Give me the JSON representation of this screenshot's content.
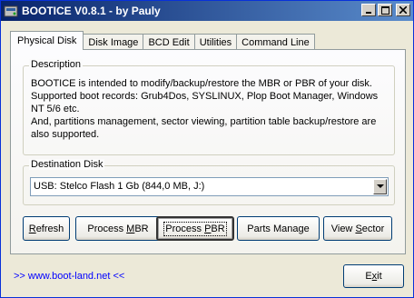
{
  "window": {
    "title": "BOOTICE V0.8.1 - by Pauly",
    "controls": {
      "minimize": "_",
      "maximize": "□",
      "close": "×"
    }
  },
  "tabs": [
    {
      "label": "Physical Disk",
      "active": true
    },
    {
      "label": "Disk Image",
      "active": false
    },
    {
      "label": "BCD Edit",
      "active": false
    },
    {
      "label": "Utilities",
      "active": false
    },
    {
      "label": "Command Line",
      "active": false
    }
  ],
  "description": {
    "title": "Description",
    "lines": [
      "BOOTICE is intended to modify/backup/restore the MBR or PBR of your disk.",
      "Supported boot records: Grub4Dos, SYSLINUX, Plop Boot Manager, Windows",
      "NT 5/6 etc.",
      "And, partitions management, sector viewing, partition table backup/restore are",
      "also supported."
    ]
  },
  "destination": {
    "title": "Destination Disk",
    "selected": "USB: Stelco  Flash 1 Gb (844,0 MB, J:)"
  },
  "buttons": {
    "refresh": {
      "pre": "",
      "key": "R",
      "post": "efresh"
    },
    "process_mbr": {
      "pre": "Process ",
      "key": "M",
      "post": "BR"
    },
    "process_pbr": {
      "pre": "Process ",
      "key": "P",
      "post": "BR"
    },
    "parts_manage": {
      "pre": "Parts Manage",
      "key": "",
      "post": ""
    },
    "view_sector": {
      "pre": "View ",
      "key": "S",
      "post": "ector"
    },
    "exit": {
      "pre": "E",
      "key": "x",
      "post": "it"
    }
  },
  "footer": {
    "link": ">> www.boot-land.net <<"
  },
  "colors": {
    "title_bar_start": "#08246b",
    "title_bar_end": "#5a8ccc",
    "link": "#0000ff"
  }
}
